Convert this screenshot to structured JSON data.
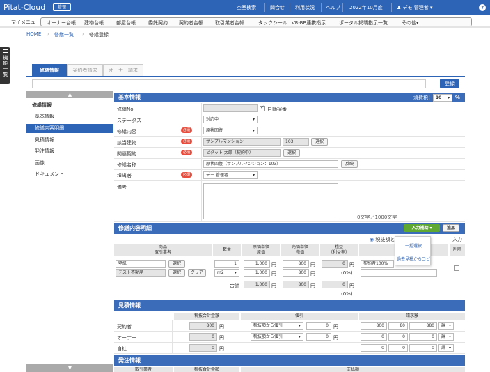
{
  "header": {
    "logo": "Pitat-Cloud",
    "badge": "管理",
    "nav": [
      "空室検索",
      "問合せ",
      "利用状況",
      "ヘルプ"
    ],
    "period": "2022年10月度",
    "user": "デモ 管理者",
    "help": "?"
  },
  "menu": {
    "label": "マイメニュー",
    "items": [
      "オーナー台帳",
      "建物台帳",
      "部屋台帳",
      "委託契約",
      "契約者台帳",
      "取引業者台帳",
      "タックシール",
      "VR-BB連携指示",
      "ポータル掲載指示一覧",
      "その他"
    ]
  },
  "breadcrumb": [
    "HOME",
    "修繕一覧",
    "修繕登録"
  ],
  "side_tab": "機能一覧",
  "tabs": [
    "修繕情報",
    "契約者請求",
    "オーナー請求"
  ],
  "register": "登録",
  "left_nav": [
    {
      "label": "修繕情報",
      "type": "head"
    },
    {
      "label": "基本情報"
    },
    {
      "label": "修繕内容明細",
      "active": true
    },
    {
      "label": "見積情報"
    },
    {
      "label": "発注情報"
    },
    {
      "label": "画像"
    },
    {
      "label": "ドキュメント"
    }
  ],
  "basic": {
    "title": "基本情報",
    "tax_label": "消費税：",
    "tax_value": "10",
    "tax_unit": "%",
    "required": "必須",
    "rows": {
      "no": "修繕No",
      "auto": "自動採番",
      "status": "ステータス",
      "status_val": "対応中",
      "content": "修繕内容",
      "content_val": "原状回復",
      "building": "該当建物",
      "building_val": "サンプルマンション",
      "room_val": "103",
      "select": "選択",
      "contract": "関連契約",
      "contract_val": "ピタット 太郎（契約中）",
      "name": "修繕名称",
      "name_val": "原状回復（サンプルマンション：103）",
      "reflect": "反映",
      "person": "担当者",
      "person_val": "デモ 管理者",
      "memo": "備考",
      "counter": "0文字／1000文字"
    }
  },
  "detail": {
    "title": "修繕内容明細",
    "input_help": "入力補助",
    "add": "追加",
    "tax_opt": "税抜額と",
    "tax_opt2": "入力",
    "headers": {
      "product": "商品",
      "vendor": "取引業者",
      "qty": "数量",
      "cost": "原価単価",
      "cost2": "原価",
      "sale": "売価単価",
      "sale2": "売価",
      "profit": "粗益",
      "profit2": "（利益率）",
      "delete": "削除"
    },
    "row": {
      "product": "壁紙",
      "select": "選択",
      "vendor": "テスト不動産",
      "select2": "選択",
      "clear": "クリア",
      "qty": "1",
      "unit": "m2",
      "cost": "1,000",
      "yen": "円",
      "cost2": "1,000",
      "sale": "800",
      "sale2": "800",
      "profit": "0",
      "rate": "(0%)",
      "bill": "契約者100%"
    },
    "total": {
      "label": "合計",
      "cost": "1,000",
      "sale": "800",
      "profit": "0",
      "rate": "(0%)"
    },
    "popup": [
      "一括選択",
      "過去見積からコピー"
    ]
  },
  "estimate": {
    "title": "見積情報",
    "h_total": "税抜合計金額",
    "h_disc": "値引",
    "h_bill": "請求額",
    "rows": [
      {
        "label": "契約者",
        "total": "800",
        "disc": "税抜額から値引",
        "disc_val": "0",
        "b1": "800",
        "b2": "80",
        "b3": "880",
        "tax": "課"
      },
      {
        "label": "オーナー",
        "total": "0",
        "disc": "税抜額から値引",
        "disc_val": "0",
        "b1": "0",
        "b2": "0",
        "b3": "0",
        "tax": "課"
      },
      {
        "label": "自社",
        "total": "0",
        "b1": "0",
        "b2": "0",
        "b3": "0",
        "tax": "課"
      }
    ],
    "yen": "円"
  },
  "order": {
    "title": "発注情報",
    "h1": "取引業者",
    "h2": "税抜合計金額",
    "h3": "支払額"
  }
}
